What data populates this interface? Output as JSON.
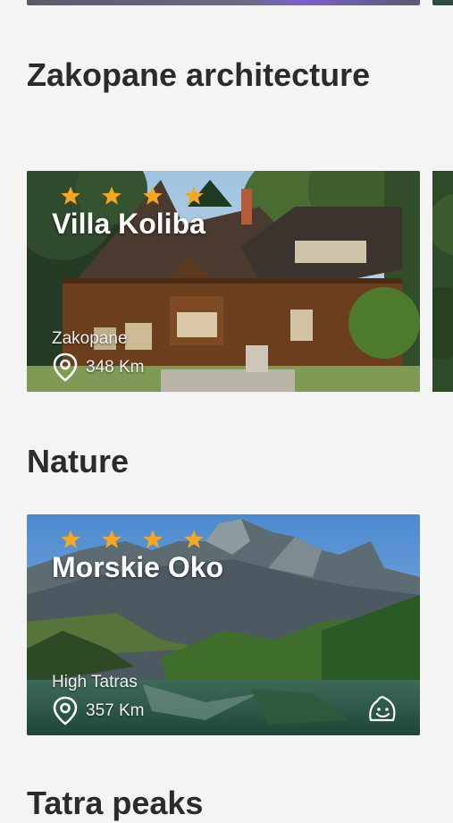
{
  "colors": {
    "background": "#f4f4f4",
    "heading": "#2b2b2b",
    "star": "#f5a623",
    "overlay_text": "#ffffff"
  },
  "sections": [
    {
      "title": "Zakopane architecture",
      "cards": [
        {
          "title": "Villa Koliba",
          "rating": 4,
          "region": "Zakopane",
          "distance": "348 Km",
          "icon": "location-pin-icon"
        }
      ]
    },
    {
      "title": "Nature",
      "cards": [
        {
          "title": "Morskie Oko",
          "rating": 4,
          "region": "High Tatras",
          "distance": "357 Km",
          "icon": "location-pin-icon",
          "badge_icon": "smiling-face-icon"
        }
      ]
    },
    {
      "title": "Tatra peaks"
    }
  ]
}
